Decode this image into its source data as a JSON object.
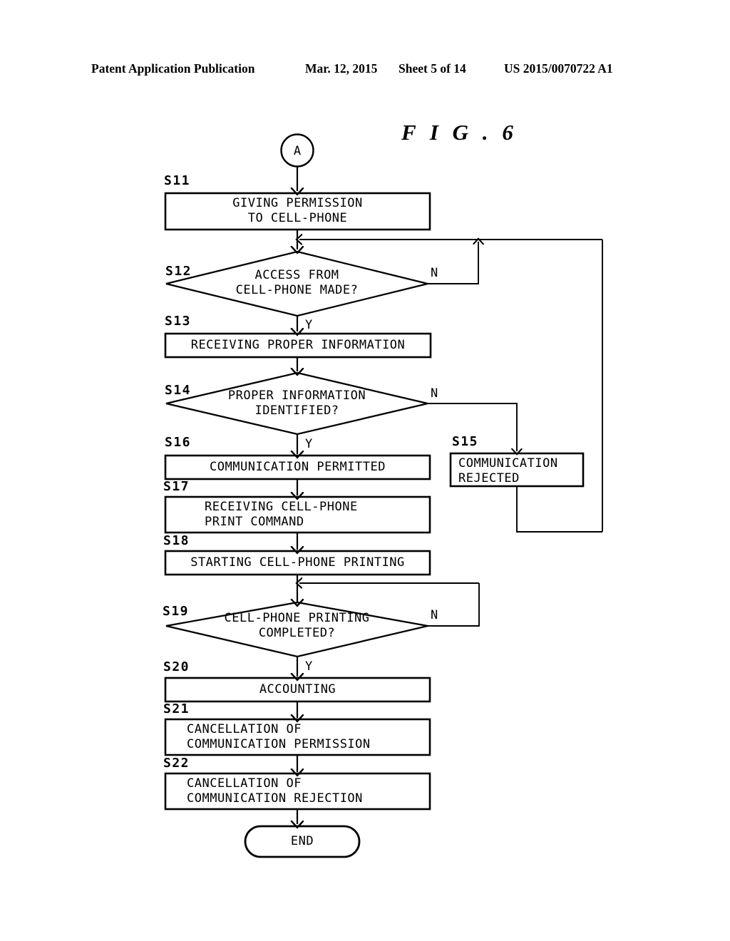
{
  "header": {
    "publication": "Patent Application Publication",
    "date": "Mar. 12, 2015",
    "sheet": "Sheet 5 of 14",
    "number": "US 2015/0070722 A1"
  },
  "figure": {
    "title": "F I G .  6",
    "entry_connector": "A",
    "end_terminal": "END"
  },
  "colors": {
    "ink": "#000000",
    "paper": "#ffffff"
  },
  "branch_labels": {
    "yes": "Y",
    "no": "N"
  },
  "steps": [
    {
      "id": "S11",
      "label": "S11",
      "shape": "process",
      "lines": [
        "GIVING PERMISSION",
        "TO CELL-PHONE"
      ],
      "text": "GIVING PERMISSION\nTO CELL-PHONE"
    },
    {
      "id": "S12",
      "label": "S12",
      "shape": "decision",
      "lines": [
        "ACCESS FROM",
        "CELL-PHONE MADE?"
      ],
      "text": "ACCESS FROM\nCELL-PHONE MADE?",
      "yes_branch": "Y",
      "no_branch": "N"
    },
    {
      "id": "S13",
      "label": "S13",
      "shape": "process",
      "lines": [
        "RECEIVING PROPER INFORMATION"
      ],
      "text": "RECEIVING PROPER INFORMATION"
    },
    {
      "id": "S14",
      "label": "S14",
      "shape": "decision",
      "lines": [
        "PROPER INFORMATION",
        "IDENTIFIED?"
      ],
      "text": "PROPER INFORMATION\nIDENTIFIED?",
      "yes_branch": "Y",
      "no_branch": "N"
    },
    {
      "id": "S15",
      "label": "S15",
      "shape": "process",
      "lines": [
        "COMMUNICATION",
        "REJECTED"
      ],
      "text": "COMMUNICATION\nREJECTED"
    },
    {
      "id": "S16",
      "label": "S16",
      "shape": "process",
      "lines": [
        "COMMUNICATION PERMITTED"
      ],
      "text": "COMMUNICATION PERMITTED"
    },
    {
      "id": "S17",
      "label": "S17",
      "shape": "process",
      "lines": [
        "RECEIVING CELL-PHONE",
        "PRINT COMMAND"
      ],
      "text": "RECEIVING CELL-PHONE\nPRINT COMMAND"
    },
    {
      "id": "S18",
      "label": "S18",
      "shape": "process",
      "lines": [
        "STARTING CELL-PHONE PRINTING"
      ],
      "text": "STARTING CELL-PHONE PRINTING"
    },
    {
      "id": "S19",
      "label": "S19",
      "shape": "decision",
      "lines": [
        "CELL-PHONE PRINTING",
        "COMPLETED?"
      ],
      "text": "CELL-PHONE PRINTING\nCOMPLETED?",
      "yes_branch": "Y",
      "no_branch": "N"
    },
    {
      "id": "S20",
      "label": "S20",
      "shape": "process",
      "lines": [
        "ACCOUNTING"
      ],
      "text": "ACCOUNTING"
    },
    {
      "id": "S21",
      "label": "S21",
      "shape": "process",
      "lines": [
        "CANCELLATION OF",
        "COMMUNICATION PERMISSION"
      ],
      "text": "CANCELLATION OF\nCOMMUNICATION PERMISSION"
    },
    {
      "id": "S22",
      "label": "S22",
      "shape": "process",
      "lines": [
        "CANCELLATION OF",
        "COMMUNICATION REJECTION"
      ],
      "text": "CANCELLATION OF\nCOMMUNICATION REJECTION"
    }
  ]
}
